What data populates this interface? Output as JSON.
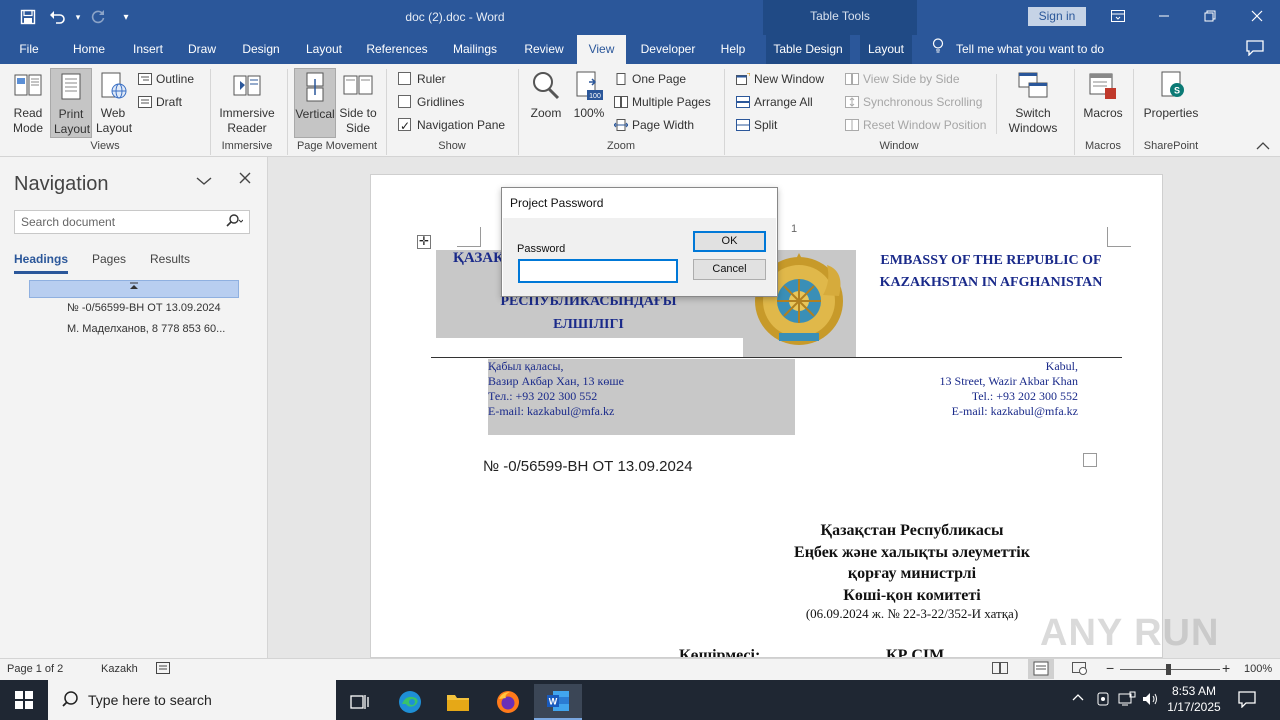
{
  "titlebar": {
    "title": "doc (2).doc  -  Word",
    "table_tools": "Table Tools",
    "sign_in": "Sign in"
  },
  "tabs": [
    "File",
    "Home",
    "Insert",
    "Draw",
    "Design",
    "Layout",
    "References",
    "Mailings",
    "Review",
    "View",
    "Developer",
    "Help",
    "Table Design",
    "Layout"
  ],
  "active_tab": "View",
  "tell_me": "Tell me what you want to do",
  "ribbon": {
    "views": {
      "read_mode": "Read Mode",
      "print_layout": "Print Layout",
      "web_layout": "Web Layout",
      "outline": "Outline",
      "draft": "Draft",
      "label": "Views"
    },
    "immersive": {
      "reader": "Immersive Reader",
      "label": "Immersive"
    },
    "page_movement": {
      "vertical": "Vertical",
      "side_to_side": "Side to Side",
      "label": "Page Movement"
    },
    "show": {
      "ruler": "Ruler",
      "ruler_checked": false,
      "gridlines": "Gridlines",
      "gridlines_checked": false,
      "navigation_pane": "Navigation Pane",
      "navigation_pane_checked": true,
      "label": "Show"
    },
    "zoom": {
      "zoom": "Zoom",
      "hundred": "100%",
      "hundred_badge": "100",
      "one_page": "One Page",
      "multiple_pages": "Multiple Pages",
      "page_width": "Page Width",
      "label": "Zoom"
    },
    "window": {
      "new_window": "New Window",
      "arrange_all": "Arrange All",
      "split": "Split",
      "view_side_by_side": "View Side by Side",
      "sync_scrolling": "Synchronous Scrolling",
      "reset_position": "Reset Window Position",
      "switch_windows": "Switch Windows",
      "label": "Window"
    },
    "macros": {
      "macros": "Macros",
      "label": "Macros"
    },
    "sharepoint": {
      "properties": "Properties",
      "label": "SharePoint"
    }
  },
  "navigation": {
    "title": "Navigation",
    "search_placeholder": "Search document",
    "tabs": [
      "Headings",
      "Pages",
      "Results"
    ],
    "active_tab": "Headings",
    "items": [
      "№ -0/56599-ВН ОТ 13.09.2024",
      "М. Маделханов, 8 778 853 60..."
    ]
  },
  "document": {
    "page_number_marker": "1",
    "kz_header_partial": "ҚАЗАҚ",
    "kz_header_line2": "РЕСПУБЛИКАСЫНДАҒЫ",
    "kz_header_line3": "ЕЛШІЛІГІ",
    "en_header_line1": "EMBASSY OF THE REPUBLIC OF",
    "en_header_line2": "KAZAKHSTAN IN AFGHANISTAN",
    "kz_address": [
      "Қабыл қаласы,",
      "Вазир Акбар Хан, 13 көше",
      "Тел.: +93 202 300 552",
      "E-mail: kazkabul@mfa.kz"
    ],
    "en_address": [
      "Kabul,",
      "13 Street, Wazir Akbar Khan",
      "Tel.: +93 202 300 552",
      "E-mail: kazkabul@mfa.kz"
    ],
    "reference": "№ -0/56599-ВН ОТ 13.09.2024",
    "recipient": [
      "Қазақстан Республикасы",
      "Еңбек және халықты әлеуметтік",
      "қорғау министрлі",
      "Көші-қон комитеті"
    ],
    "recipient_note": "(06.09.2024 ж. № 22-3-22/352-И хатқа)",
    "copy_label": "Көшірмесі:",
    "copy_value": "КР СІМ"
  },
  "dialog": {
    "title": "Project Password",
    "password_label": "Password",
    "password_value": "",
    "ok": "OK",
    "cancel": "Cancel"
  },
  "statusbar": {
    "page": "Page 1 of 2",
    "language": "Kazakh",
    "zoom": "100%",
    "zoom_minus": "−",
    "zoom_plus": "+"
  },
  "taskbar": {
    "search_placeholder": "Type here to search",
    "time": "8:53 AM",
    "date": "1/17/2025"
  },
  "watermark": "ANY RUN",
  "colors": {
    "word_blue": "#2b579a",
    "navy_text": "#1a2a8a"
  }
}
